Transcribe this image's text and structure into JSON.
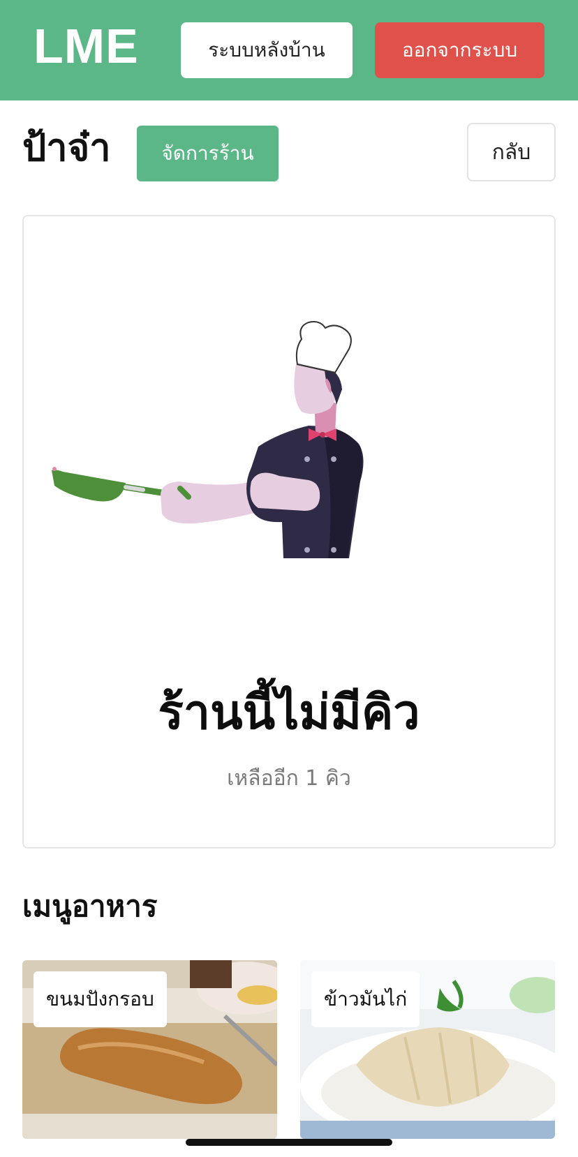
{
  "navbar": {
    "brand": "LME",
    "backend_label": "ระบบหลังบ้าน",
    "logout_label": "ออกจากระบบ"
  },
  "shop": {
    "name": "ป้าจ๋า",
    "manage_label": "จัดการร้าน",
    "back_label": "กลับ"
  },
  "queue": {
    "title": "ร้านนี้ไม่มีคิว",
    "subtitle": "เหลืออีก 1 คิว"
  },
  "menu": {
    "heading": "เมนูอาหาร",
    "items": [
      {
        "label": "ขนมปังกรอบ"
      },
      {
        "label": "ข้าวมันไก่"
      }
    ]
  },
  "colors": {
    "brand_green": "#5bb787",
    "logout_red": "#e0514b"
  }
}
